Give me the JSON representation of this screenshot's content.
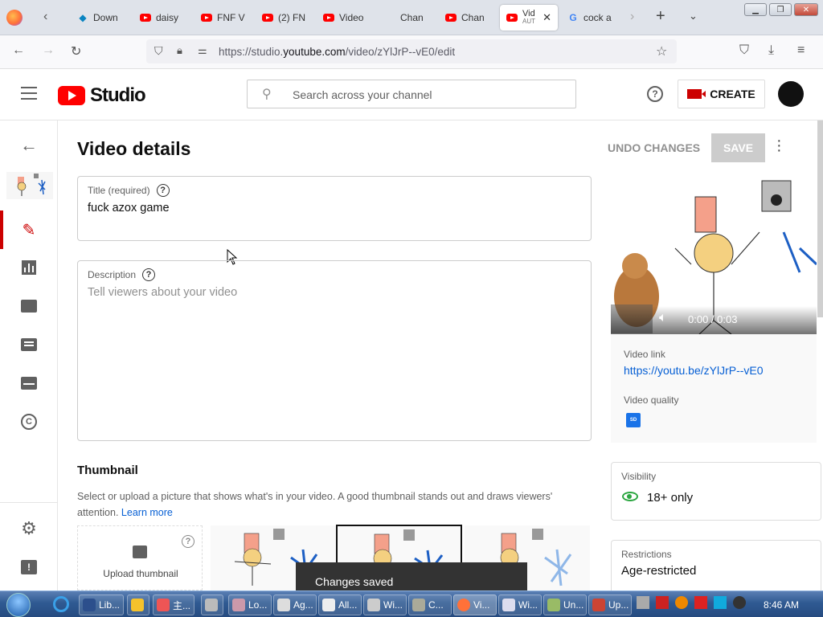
{
  "browser": {
    "tabs": [
      {
        "label": "Down",
        "icon": "download-icon"
      },
      {
        "label": "daisy",
        "icon": "youtube-icon"
      },
      {
        "label": "FNF V",
        "icon": "youtube-icon"
      },
      {
        "label": "(2) FN",
        "icon": "youtube-icon"
      },
      {
        "label": "Video",
        "icon": "youtube-icon"
      },
      {
        "label": "Chan",
        "icon": "studio-icon"
      },
      {
        "label": "Chan",
        "icon": "youtube-icon"
      },
      {
        "label": "Vid",
        "sublabel": "AUT",
        "icon": "youtube-icon",
        "active": true
      },
      {
        "label": "cock a",
        "icon": "google-icon"
      }
    ],
    "url_prefix": "https://studio.",
    "url_domain": "youtube.com",
    "url_suffix": "/video/zYlJrP--vE0/edit"
  },
  "header": {
    "logo_text": "Studio",
    "search_placeholder": "Search across your channel",
    "create_label": "CREATE"
  },
  "main": {
    "page_title": "Video details",
    "undo_label": "UNDO CHANGES",
    "save_label": "SAVE",
    "title_field": {
      "label": "Title (required)",
      "value": "fuck azox game"
    },
    "description_field": {
      "label": "Description",
      "placeholder": "Tell viewers about your video"
    },
    "thumbnail": {
      "heading": "Thumbnail",
      "help_text": "Select or upload a picture that shows what's in your video. A good thumbnail stands out and draws viewers' attention.",
      "learn_more": "Learn more",
      "upload_label": "Upload thumbnail"
    }
  },
  "preview": {
    "time": "0:00 / 0:03",
    "video_link_label": "Video link",
    "video_link": "https://youtu.be/zYlJrP--vE0",
    "video_quality_label": "Video quality",
    "quality_badge": "SD"
  },
  "visibility": {
    "label": "Visibility",
    "value": "18+ only"
  },
  "restrictions": {
    "label": "Restrictions",
    "value": "Age-restricted"
  },
  "toast": {
    "message": "Changes saved"
  },
  "taskbar": {
    "items": [
      "Lib...",
      "",
      "主...",
      "",
      "Lo...",
      "Ag...",
      "All...",
      "Wi...",
      "C...",
      "Vi...",
      "Wi...",
      "Un...",
      "Up..."
    ],
    "clock": "8:46 AM"
  },
  "colors": {
    "brand_red": "#ff0000",
    "link_blue": "#065fd4",
    "active_red": "#cc0000",
    "eye_green": "#2ba640"
  }
}
